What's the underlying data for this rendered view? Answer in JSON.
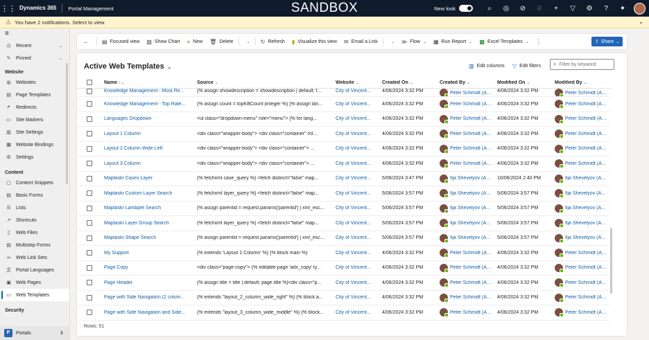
{
  "topbar": {
    "brand": "Dynamics 365",
    "app_name": "Portal Management",
    "environment": "SANDBOX",
    "new_look_label": "New look",
    "new_look_on": true
  },
  "notification": {
    "text": "You have 2 notifications. Select to view."
  },
  "sidebar": {
    "top_items": [
      {
        "label": "Recent",
        "icon": "clock-icon"
      },
      {
        "label": "Pinned",
        "icon": "pin-icon"
      }
    ],
    "groups": [
      {
        "title": "Website",
        "items": [
          {
            "label": "Websites",
            "icon": "globe-icon"
          },
          {
            "label": "Page Templates",
            "icon": "page-icon"
          },
          {
            "label": "Redirects",
            "icon": "redirect-icon"
          },
          {
            "label": "Site Markers",
            "icon": "marker-icon"
          },
          {
            "label": "Site Settings",
            "icon": "settings-icon"
          },
          {
            "label": "Website Bindings",
            "icon": "binding-icon"
          },
          {
            "label": "Settings",
            "icon": "gear-icon"
          }
        ]
      },
      {
        "title": "Content",
        "items": [
          {
            "label": "Content Snippets",
            "icon": "snippet-icon"
          },
          {
            "label": "Basic Forms",
            "icon": "form-icon"
          },
          {
            "label": "Lists",
            "icon": "list-icon"
          },
          {
            "label": "Shortcuts",
            "icon": "shortcut-icon"
          },
          {
            "label": "Web Files",
            "icon": "file-icon"
          },
          {
            "label": "Multistep Forms",
            "icon": "multistep-icon"
          },
          {
            "label": "Web Link Sets",
            "icon": "link-icon"
          },
          {
            "label": "Portal Languages",
            "icon": "language-icon"
          },
          {
            "label": "Web Pages",
            "icon": "webpage-icon"
          },
          {
            "label": "Web Templates",
            "icon": "template-icon",
            "selected": true
          }
        ]
      },
      {
        "title": "Security",
        "items": []
      }
    ],
    "area_switcher": {
      "badge": "P",
      "label": "Portals"
    }
  },
  "commandbar": {
    "items": [
      {
        "label": "Focused view",
        "icon": "focused-view-icon"
      },
      {
        "label": "Show Chart",
        "icon": "chart-icon"
      },
      {
        "label": "New",
        "icon": "plus-icon"
      },
      {
        "label": "Delete",
        "icon": "trash-icon"
      },
      {
        "label": "Refresh",
        "icon": "refresh-icon"
      },
      {
        "label": "Visualize this view",
        "icon": "visualize-icon"
      },
      {
        "label": "Email a Link",
        "icon": "mail-icon"
      },
      {
        "label": "Flow",
        "icon": "flow-icon"
      },
      {
        "label": "Run Report",
        "icon": "report-icon"
      },
      {
        "label": "Excel Templates",
        "icon": "excel-icon"
      }
    ],
    "share_label": "Share"
  },
  "view": {
    "title": "Active Web Templates",
    "edit_columns": "Edit columns",
    "edit_filters": "Edit filters",
    "keyword_placeholder": "Filter by keyword",
    "rows_count": "Rows: 51"
  },
  "grid": {
    "columns": [
      "Name",
      "Source",
      "Website",
      "Created On",
      "Created By",
      "Modified On",
      "Modified By"
    ],
    "rows": [
      [
        "Knowledge Management - Most Re...",
        "{% assign showdescription = showdescription | default: f...",
        "City of Vincent...",
        "4/06/2024 3:32 PM",
        "Peter Schmidt (Avai...",
        "4/06/2024 3:32 PM",
        "Peter Schmidt (Avai..."
      ],
      [
        "Knowledge Management - Top Rate...",
        "{% assign count = topKBCount |integer %} {% assign lan...",
        "City of Vincent...",
        "4/06/2024 3:32 PM",
        "Peter Schmidt (Avai...",
        "4/06/2024 3:32 PM",
        "Peter Schmidt (Avai..."
      ],
      [
        "Languages Dropdown",
        "<ul class=\"dropdown-menu\" role=\"menu\"> {% for lang...",
        "City of Vincent...",
        "4/06/2024 3:32 PM",
        "Peter Schmidt (Avai...",
        "4/06/2024 3:32 PM",
        "Peter Schmidt (Avai..."
      ],
      [
        "Layout 1 Column",
        "<div class=\"wrapper-body\"> <div class=\"container\" rol...",
        "City of Vincent...",
        "4/06/2024 3:32 PM",
        "Peter Schmidt (Avai...",
        "4/06/2024 3:32 PM",
        "Peter Schmidt (Avai..."
      ],
      [
        "Layout 2 Column Wide Left",
        "<div class=\"wrapper-body\"> <div class=\"container\"> ...",
        "City of Vincent...",
        "4/06/2024 3:32 PM",
        "Peter Schmidt (Avai...",
        "4/06/2024 3:32 PM",
        "Peter Schmidt (Avai..."
      ],
      [
        "Layout 3 Column",
        "<div class=\"wrapper-body\"> <div class=\"container\"> ...",
        "City of Vincent...",
        "4/06/2024 3:32 PM",
        "Peter Schmidt (Avai...",
        "4/06/2024 3:32 PM",
        "Peter Schmidt (Avai..."
      ],
      [
        "Maptaskr Cases Layer",
        "{% fetchxml case_query %} <fetch distinct=\"false\" map...",
        "City of Vincent...",
        "5/06/2024 3:47 PM",
        "Ilja Shevelyov (Availa...",
        "10/06/2024 2:40 PM",
        "Ilja Shevelyov (Availa..."
      ],
      [
        "Maptaskr Custom Layer Search",
        "{% fetchxml layer_query %} <fetch distinct=\"false\" map...",
        "City of Vincent...",
        "5/06/2024 3:57 PM",
        "Ilja Shevelyov (Availa...",
        "5/06/2024 3:57 PM",
        "Ilja Shevelyov (Availa..."
      ],
      [
        "Maptaskr Lambpet Search",
        "{% assign parentid = request.params['parentid'] | xml_esc...",
        "City of Vincent...",
        "5/06/2024 3:57 PM",
        "Ilja Shevelyov (Availa...",
        "5/06/2024 3:57 PM",
        "Ilja Shevelyov (Availa..."
      ],
      [
        "Maptaskr Layer Group Search",
        "{% fetchxml layer_query %} <fetch distinct=\"false\" map...",
        "City of Vincent...",
        "5/06/2024 3:57 PM",
        "Ilja Shevelyov (Availa...",
        "5/06/2024 3:57 PM",
        "Ilja Shevelyov (Availa..."
      ],
      [
        "Maptaskr Shape Search",
        "{% assign parentid = request.params['parentid'] | xml_esc...",
        "City of Vincent...",
        "5/06/2024 3:57 PM",
        "Ilja Shevelyov (Availa...",
        "5/06/2024 3:57 PM",
        "Ilja Shevelyov (Availa..."
      ],
      [
        "My Support",
        "{% extends 'Layout 1 Column' %} {% block main %}",
        "City of Vincent...",
        "4/06/2024 3:32 PM",
        "Peter Schmidt (Avai...",
        "4/06/2024 3:32 PM",
        "Peter Schmidt (Avai..."
      ],
      [
        "Page Copy",
        "<div class=\"page-copy\"> {% editable page 'adx_copy' ty...",
        "City of Vincent...",
        "4/06/2024 3:32 PM",
        "Peter Schmidt (Avai...",
        "4/06/2024 3:32 PM",
        "Peter Schmidt (Avai..."
      ],
      [
        "Page Header",
        "{% assign title = title | default: page.title %}<div class=\"p...",
        "City of Vincent...",
        "4/06/2024 3:32 PM",
        "Peter Schmidt (Avai...",
        "4/06/2024 3:32 PM",
        "Peter Schmidt (Avai..."
      ],
      [
        "Page with Side Navigation (2 colum...",
        "{% extends \"layout_2_column_wide_right\" %} {% block a...",
        "City of Vincent...",
        "4/06/2024 3:32 PM",
        "Peter Schmidt (Avai...",
        "4/06/2024 3:32 PM",
        "Peter Schmidt (Avai..."
      ],
      [
        "Page with Side Navigation and Side...",
        "{% extends \"layout_3_column_wide_middle\" %} {% block...",
        "City of Vincent...",
        "4/06/2024 3:32 PM",
        "Peter Schmidt (Avai...",
        "4/06/2024 3:32 PM",
        "Peter Schmidt (Avai..."
      ]
    ]
  }
}
